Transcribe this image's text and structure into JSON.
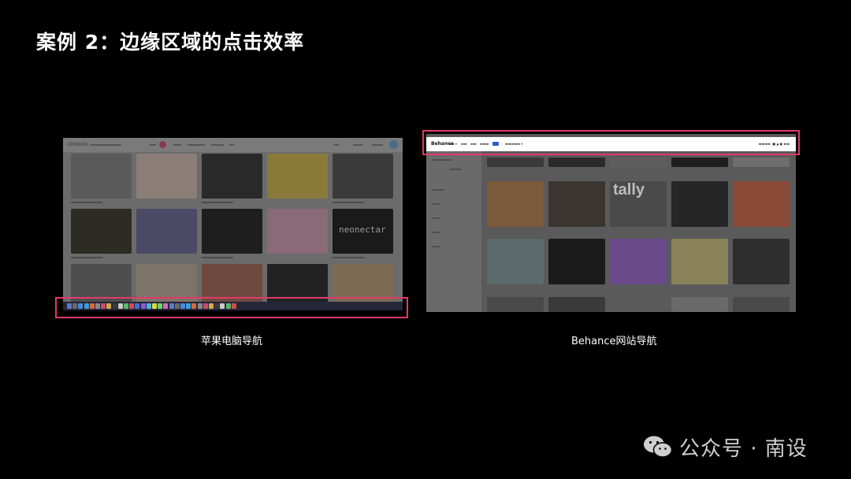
{
  "slide": {
    "title": "案例 2：边缘区域的点击效率"
  },
  "left_example": {
    "caption": "苹果电脑导航",
    "screenshot_text": {
      "tile_wordmark": "neonectar"
    }
  },
  "right_example": {
    "caption": "Behance网站导航",
    "screenshot_text": {
      "logo": "Behance",
      "tile_wordmark": "tally"
    }
  },
  "watermark": {
    "text": "公众号 · 南设"
  },
  "colors": {
    "background": "#000000",
    "highlight": "#e03a6a",
    "title": "#ffffff",
    "caption": "#ffffff",
    "watermark": "#cfcfcf"
  }
}
